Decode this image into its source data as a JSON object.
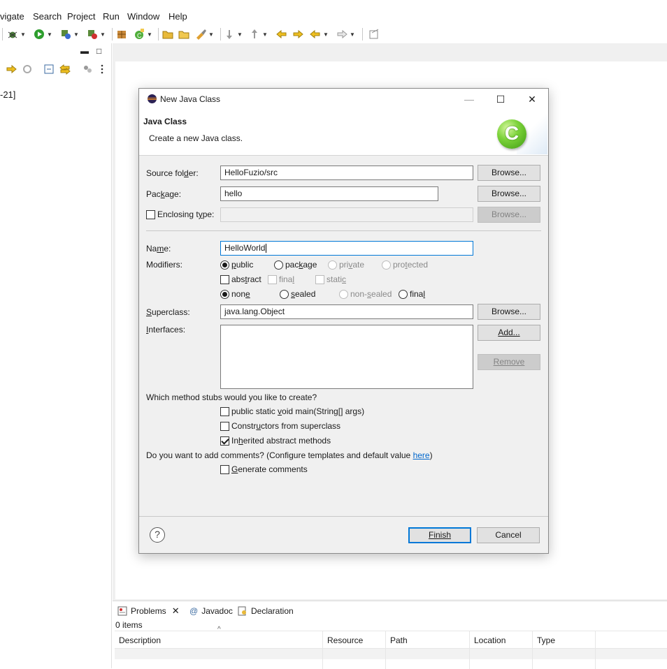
{
  "menu": {
    "items": [
      "vigate",
      "Search",
      "Project",
      "Run",
      "Window",
      "Help"
    ]
  },
  "left_view": {
    "tree_text": "-21]",
    "minimize_glyph": "▬",
    "maximize_glyph": "□"
  },
  "dialog": {
    "window_title": "New Java Class",
    "banner_title": "Java Class",
    "banner_description": "Create a new Java class.",
    "logo_letter": "C",
    "source_folder": {
      "label_pre": "Source fol",
      "label_u": "d",
      "label_post": "er:",
      "value": "HelloFuzio/src",
      "browse": "Browse..."
    },
    "package": {
      "label_pre": "Pac",
      "label_u": "k",
      "label_post": "age:",
      "value": "hello",
      "browse": "Browse..."
    },
    "enclosing": {
      "label_pre": "Enclosing t",
      "label_u": "y",
      "label_post": "pe:",
      "value": "",
      "browse": "Browse..."
    },
    "name": {
      "label_pre": "Na",
      "label_u": "m",
      "label_post": "e:",
      "value": "HelloWorld"
    },
    "modifiers": {
      "label": "Modifiers:",
      "row1": [
        {
          "pre": "",
          "u": "p",
          "post": "ublic",
          "checked": true,
          "disabled": false
        },
        {
          "pre": "pac",
          "u": "k",
          "post": "age",
          "checked": false,
          "disabled": false
        },
        {
          "pre": "pri",
          "u": "v",
          "post": "ate",
          "checked": false,
          "disabled": true
        },
        {
          "pre": "pro",
          "u": "t",
          "post": "ected",
          "checked": false,
          "disabled": true
        }
      ],
      "row2": [
        {
          "pre": "abs",
          "u": "t",
          "post": "ract",
          "checked": false,
          "disabled": false
        },
        {
          "pre": "fina",
          "u": "l",
          "post": "",
          "checked": false,
          "disabled": true
        },
        {
          "pre": "stati",
          "u": "c",
          "post": "",
          "checked": false,
          "disabled": true
        }
      ],
      "row3": [
        {
          "pre": "non",
          "u": "e",
          "post": "",
          "checked": true,
          "disabled": false
        },
        {
          "pre": "",
          "u": "s",
          "post": "ealed",
          "checked": false,
          "disabled": false
        },
        {
          "pre": "non-",
          "u": "s",
          "post": "ealed",
          "checked": false,
          "disabled": true
        },
        {
          "pre": "fina",
          "u": "l",
          "post": "",
          "checked": false,
          "disabled": false
        }
      ]
    },
    "superclass": {
      "label_pre": "",
      "label_u": "S",
      "label_post": "uperclass:",
      "value": "java.lang.Object",
      "browse": "Browse..."
    },
    "interfaces": {
      "label_pre": "",
      "label_u": "I",
      "label_post": "nterfaces:",
      "add": "Add...",
      "remove": "Remove"
    },
    "stubs": {
      "question": "Which method stubs would you like to create?",
      "items": [
        {
          "pre": "public static ",
          "u": "v",
          "post": "oid main(String[] args)",
          "checked": false
        },
        {
          "pre": "Constr",
          "u": "u",
          "post": "ctors from superclass",
          "checked": false
        },
        {
          "pre": "In",
          "u": "h",
          "post": "erited abstract methods",
          "checked": true
        }
      ]
    },
    "comments": {
      "question": "Do you want to add comments? (Configure templates and default value ",
      "link": "here",
      "question_end": ")",
      "generate": {
        "pre": "",
        "u": "G",
        "post": "enerate comments",
        "checked": false
      }
    },
    "help_glyph": "?",
    "finish": "Finish",
    "cancel": "Cancel"
  },
  "bottom": {
    "tabs": [
      "Problems",
      "Javadoc",
      "Declaration"
    ],
    "items_count": "0 items",
    "columns": [
      "Description",
      "Resource",
      "Path",
      "Location",
      "Type"
    ],
    "sort_glyph": "^"
  }
}
